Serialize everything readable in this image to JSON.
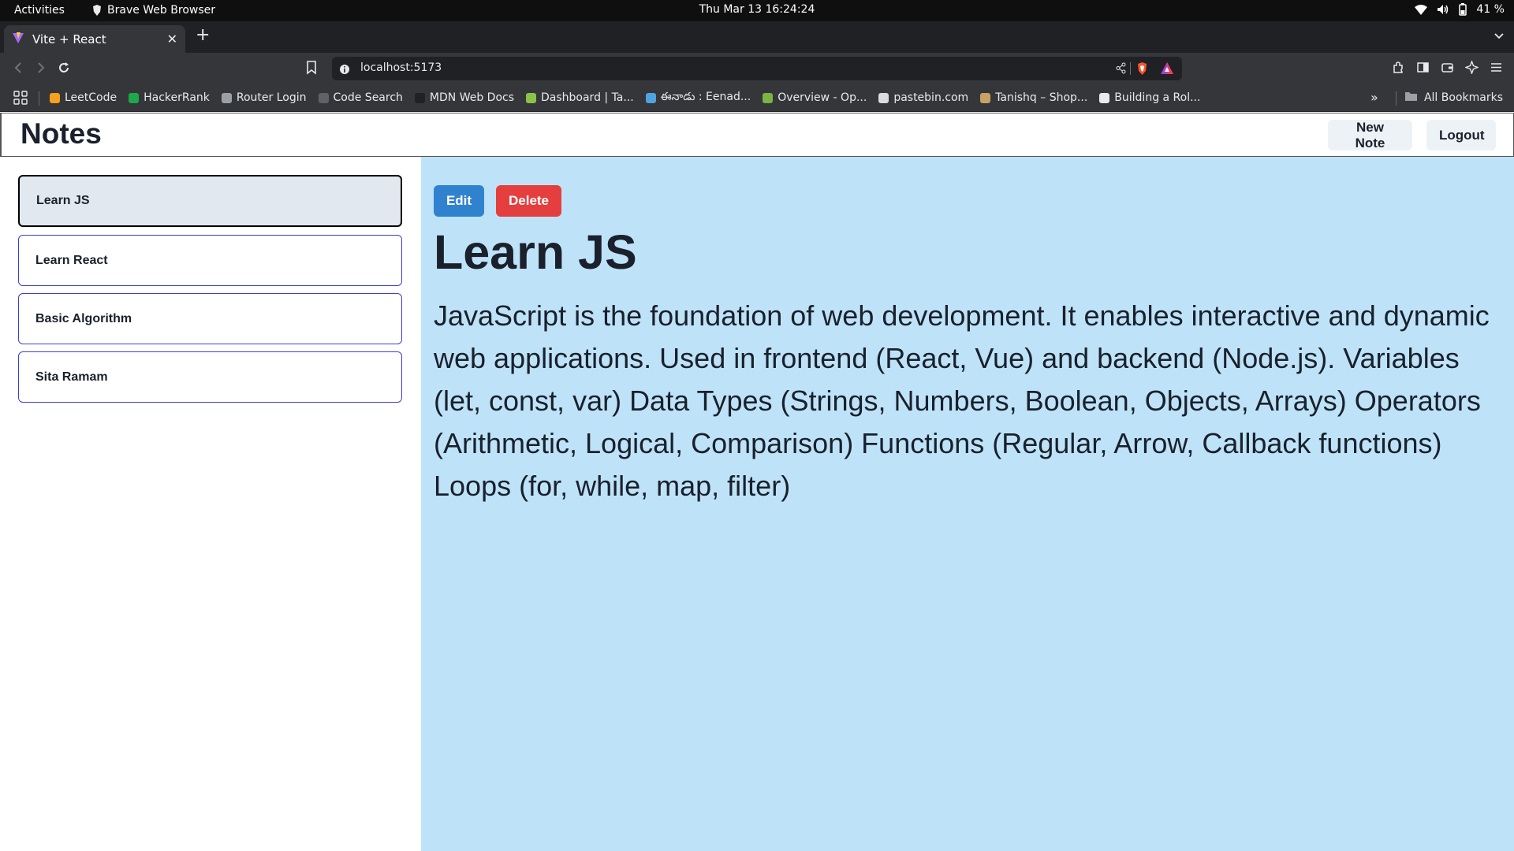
{
  "system_bar": {
    "activities": "Activities",
    "app_name": "Brave Web Browser",
    "clock": "Thu Mar 13  16:24:24",
    "battery": "41 %"
  },
  "browser": {
    "tab_title": "Vite + React",
    "url": "localhost:5173",
    "bookmarks": [
      {
        "label": "LeetCode",
        "color": "#f89f1b"
      },
      {
        "label": "HackerRank",
        "color": "#1ba94c"
      },
      {
        "label": "Router Login",
        "color": "#9aa0a6"
      },
      {
        "label": "Code Search",
        "color": "#5f6368"
      },
      {
        "label": "MDN Web Docs",
        "color": "#202124"
      },
      {
        "label": "Dashboard | Ta...",
        "color": "#8bc34a"
      },
      {
        "label": "ఈనాడు : Eenad...",
        "color": "#4fa3e0"
      },
      {
        "label": "Overview - Op...",
        "color": "#7cb342"
      },
      {
        "label": "pastebin.com",
        "color": "#dadce0"
      },
      {
        "label": "Tanishq – Shop...",
        "color": "#c8a165"
      },
      {
        "label": "Building a Rol...",
        "color": "#e8eaed"
      }
    ],
    "more_bookmarks": "»",
    "all_bookmarks": "All Bookmarks"
  },
  "app": {
    "title": "Notes",
    "new_note_label": "New Note",
    "logout_label": "Logout",
    "notes": [
      "Learn JS",
      "Learn React",
      "Basic Algorithm",
      "Sita Ramam"
    ],
    "selected_note": {
      "edit_label": "Edit",
      "delete_label": "Delete",
      "title": "Learn JS",
      "body": "JavaScript is the foundation of web development. It enables interactive and dynamic web applications. Used in frontend (React, Vue) and backend (Node.js). Variables (let, const, var) Data Types (Strings, Numbers, Boolean, Objects, Arrays) Operators (Arithmetic, Logical, Comparison) Functions (Regular, Arrow, Callback functions) Loops (for, while, map, filter)"
    }
  }
}
